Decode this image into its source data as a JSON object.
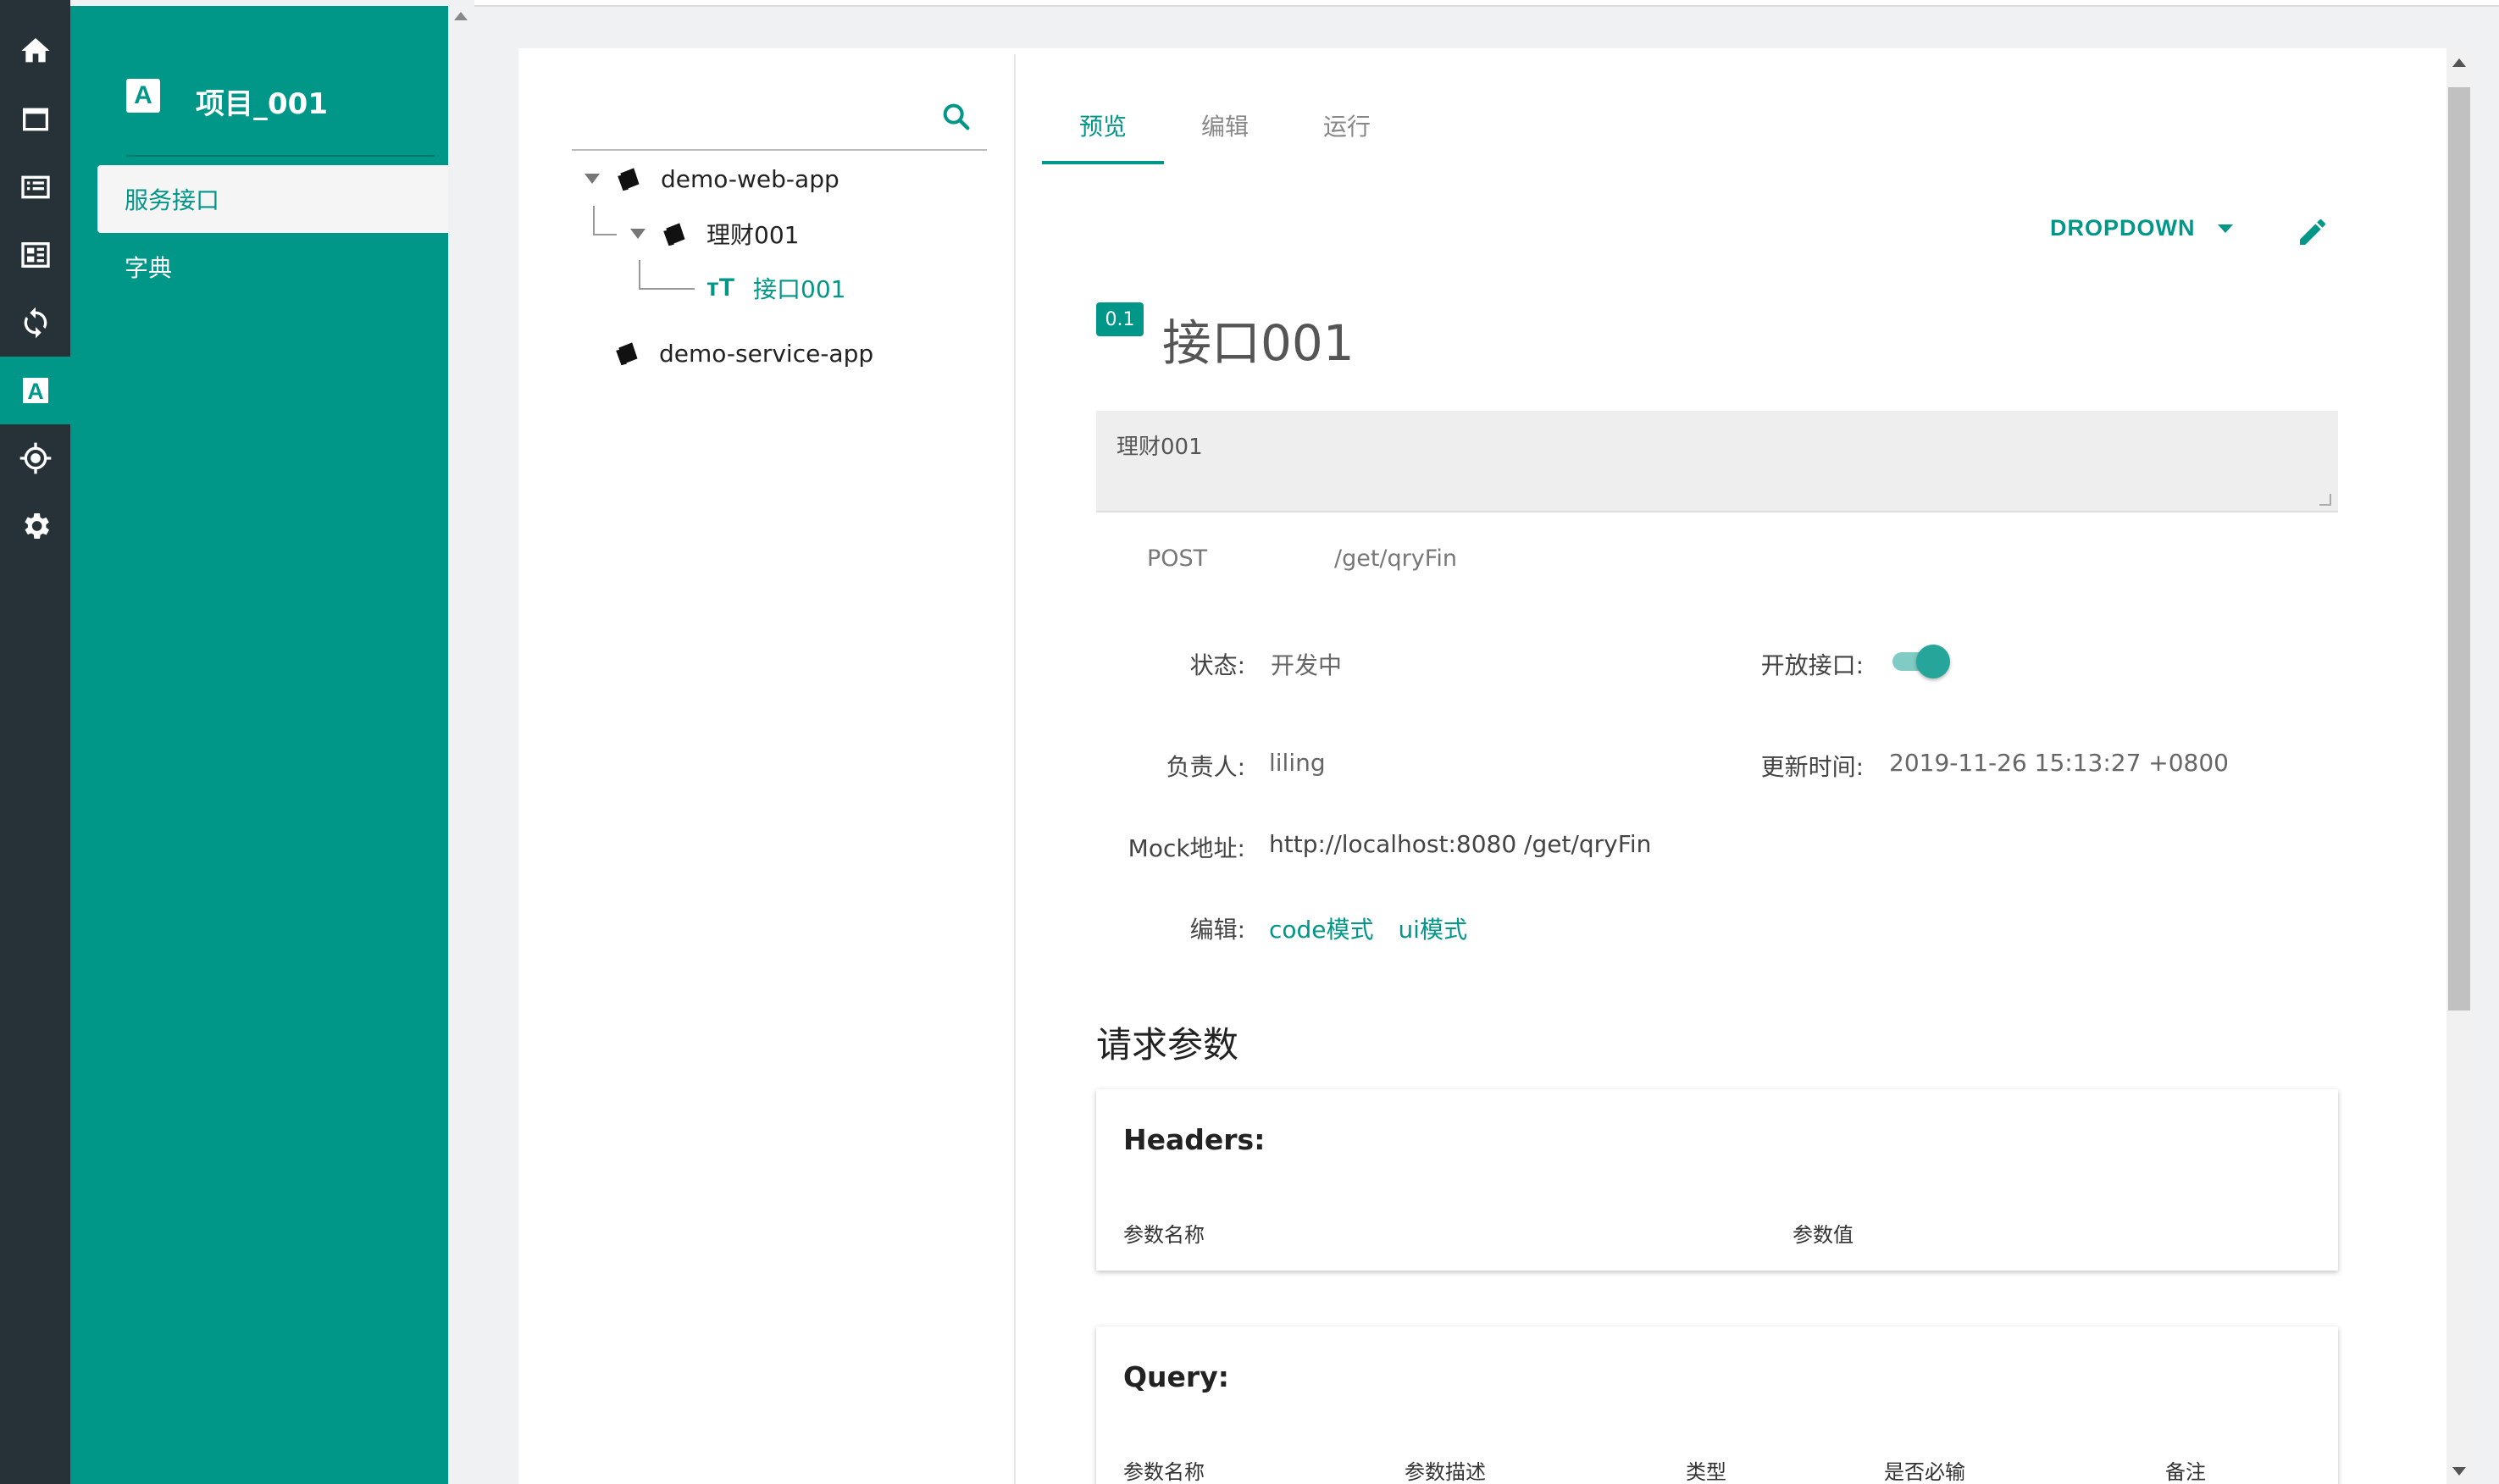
{
  "rail": {
    "items": [
      {
        "icon": "home-icon"
      },
      {
        "icon": "window-icon"
      },
      {
        "icon": "list-icon"
      },
      {
        "icon": "dashboard-icon"
      },
      {
        "icon": "sync-icon"
      },
      {
        "icon": "api-a-icon",
        "label": "A"
      },
      {
        "icon": "target-icon"
      },
      {
        "icon": "gear-icon"
      }
    ]
  },
  "nav": {
    "logo_letter": "A",
    "project_title": "项目_001",
    "items": [
      {
        "label": "服务接口",
        "active": true
      },
      {
        "label": "字典",
        "active": false
      }
    ]
  },
  "tree": {
    "nodes": [
      {
        "label": "demo-web-app"
      },
      {
        "label": "理财001"
      },
      {
        "label": "接口001",
        "leaf_icon": "тT"
      },
      {
        "label": "demo-service-app"
      }
    ]
  },
  "tabs": [
    {
      "label": "预览",
      "active": true
    },
    {
      "label": "编辑"
    },
    {
      "label": "运行"
    }
  ],
  "toolbar": {
    "dropdown_label": "DROPDOWN"
  },
  "api": {
    "version": "0.1",
    "title": "接口001",
    "description": "理财001",
    "method": "POST",
    "path": "/get/qryFin"
  },
  "fields": {
    "status_label": "状态:",
    "status_value": "开发中",
    "open_label": "开放接口:",
    "open_value": true,
    "owner_label": "负责人:",
    "owner_value": "liling",
    "updated_label": "更新时间:",
    "updated_value": "2019-11-26 15:13:27 +0800",
    "mock_label": "Mock地址:",
    "mock_value": "http://localhost:8080 /get/qryFin",
    "edit_label": "编辑:",
    "edit_code": "code模式",
    "edit_ui": "ui模式"
  },
  "request": {
    "section_title": "请求参数",
    "headers": {
      "title": "Headers:",
      "columns": [
        "参数名称",
        "参数值"
      ]
    },
    "query": {
      "title": "Query:",
      "columns": [
        "参数名称",
        "参数描述",
        "类型",
        "是否必输",
        "备注"
      ]
    }
  },
  "colors": {
    "accent": "#009688",
    "rail": "#263238"
  }
}
